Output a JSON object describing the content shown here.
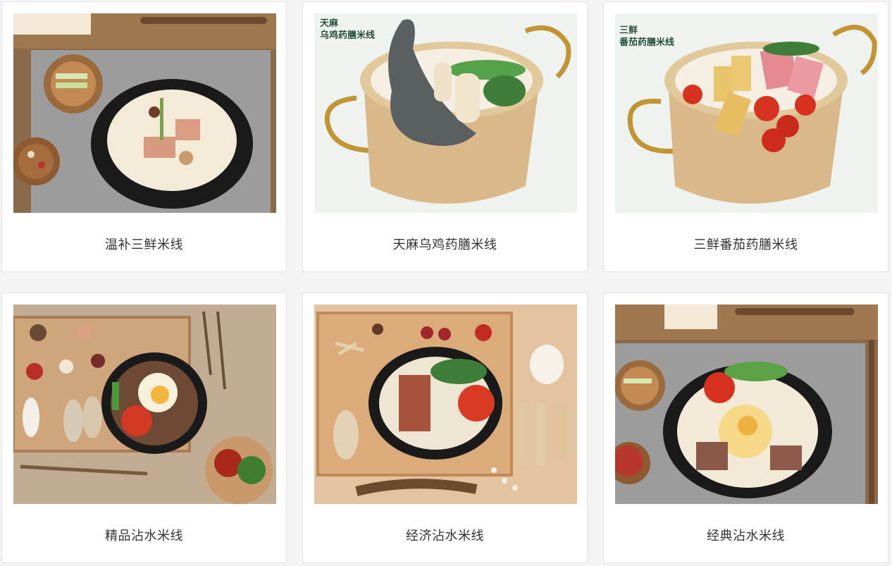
{
  "products": [
    {
      "name": "温补三鲜米线"
    },
    {
      "name": "天麻乌鸡药膳米线",
      "overlay": [
        "天麻",
        "乌鸡药膳米线"
      ]
    },
    {
      "name": "三鲜番茄药膳米线",
      "overlay": [
        "三鲜",
        "番茄药膳米线"
      ]
    },
    {
      "name": "精品沾水米线"
    },
    {
      "name": "经济沾水米线"
    },
    {
      "name": "经典沾水米线"
    }
  ]
}
